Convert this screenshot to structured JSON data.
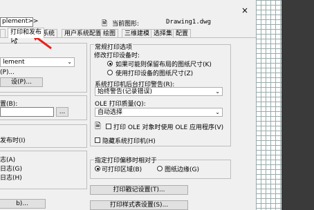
{
  "top": {
    "profile_label": "plement>>",
    "current_drawing_label": "当前图形:",
    "current_drawing_value": "Drawing1.dwg"
  },
  "tabs": [
    "打印和发布",
    "系统",
    "用户系统配置",
    "绘图",
    "三维建模",
    "选择集",
    "配置"
  ],
  "left": {
    "combo_value": "lement",
    "button1": "(P)...",
    "button2": "设(P)...",
    "label_location": "置(B):",
    "browse_button": "...",
    "label_publish": "发布时(I)",
    "opt_a": "志(A)",
    "opt_g": "日志(G)",
    "opt_h": "日志(H)",
    "bottom_button": "b)..."
  },
  "right": {
    "general_options_title": "常规打印选项",
    "modify_device_label": "修改打印设备时:",
    "radio_keep_layout": "如果可能则保留布局的图纸尺寸(K)",
    "radio_use_device": "使用打印设备的图纸尺寸(Z)",
    "spool_alert_label": "系统打印机后台打印警告(R):",
    "spool_alert_value": "始终警告(记录错误)",
    "ole_quality_label": "OLE 打印质量(Q):",
    "ole_quality_value": "自动选择",
    "ole_app_check": "打印 OLE 对象时使用 OLE 应用程序(V)",
    "hide_printers_check": "隐藏系统打印机(H)",
    "offset_title": "指定打印偏移时相对于",
    "radio_printable": "可打印区域(B)",
    "radio_paper_edge": "图纸边缘(G)",
    "stamp_button": "打印戳记设置(T)...",
    "style_button": "打印样式表设置(S)..."
  },
  "window": {
    "close_glyph": "×"
  },
  "colors": {
    "arrow": "#e8201a",
    "dialog_bg": "#f0f0f0"
  }
}
